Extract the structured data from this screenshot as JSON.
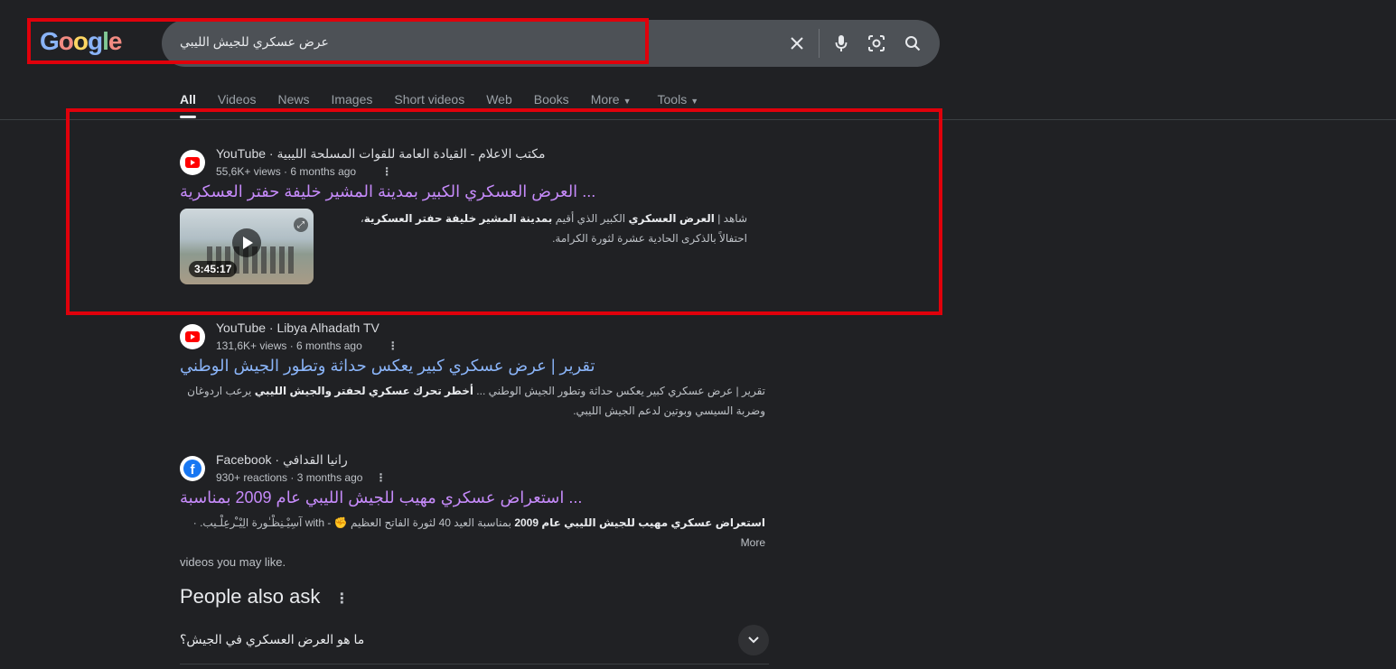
{
  "logo": {
    "letters": [
      "G",
      "o",
      "o",
      "g",
      "l",
      "e"
    ]
  },
  "search": {
    "query": "عرض عسكري للجيش الليبي"
  },
  "tabs": [
    {
      "label": "All"
    },
    {
      "label": "Videos"
    },
    {
      "label": "News"
    },
    {
      "label": "Images"
    },
    {
      "label": "Short videos"
    },
    {
      "label": "Web"
    },
    {
      "label": "Books"
    },
    {
      "label": "More"
    },
    {
      "label": "Tools"
    }
  ],
  "results": [
    {
      "source": "YouTube · مكتب الاعلام - القيادة العامة للقوات المسلحة الليبية",
      "meta": "55,6K+ views · 6 months ago",
      "title": "العرض العسكري الكبير بمدينة المشير خليفة حفتر العسكرية ...",
      "video": {
        "duration": "3:45:17"
      },
      "snippet_bold_1": "العرض العسكري",
      "snippet_pre": "شاهد | ",
      "snippet_mid": " الكبير الذي أقيم ",
      "snippet_bold_2": "بمدينة المشير خليفة حفتر العسكرية",
      "snippet_post": "، احتفالاً بالذكرى الحادية عشرة لثورة الكرامة."
    },
    {
      "source": "YouTube · Libya Alhadath TV",
      "meta": "131,6K+ views · 6 months ago",
      "title": "تقرير | عرض عسكري كبير يعكس حداثة وتطور الجيش الوطني",
      "snippet_pre": "تقرير | عرض عسكري كبير يعكس حداثة وتطور الجيش الوطني ... ",
      "snippet_bold": "أخطر تحرك عسكري لحفتر والجيش الليبي",
      "snippet_post": " يرعب اردوغان وضربة السيسي وبوتين لدعم الجيش الليبي."
    },
    {
      "source": "Facebook · رانيا القدافي",
      "meta": "930+ reactions · 3 months ago",
      "title": "استعراض عسكري مهيب للجيش الليبي عام 2009 بمناسبة ...",
      "snippet_bold": "استعراض عسكري مهيب للجيش الليبي عام 2009",
      "snippet_post": " بمناسبة العيد 40 لثورة الفاتح العظيم ✊ - with آسِيْـنِظْـٰورة الِيْ̊ـرعِلْـيب. · More",
      "snippet_line2": "videos you may like."
    }
  ],
  "paa": {
    "title": "People also ask",
    "question": "ما هو العرض العسكري في الجيش؟"
  },
  "colors": {
    "highlight_box": "#e0000b",
    "visited_link": "#c58af9",
    "link": "#8ab4f8",
    "background": "#202124"
  }
}
